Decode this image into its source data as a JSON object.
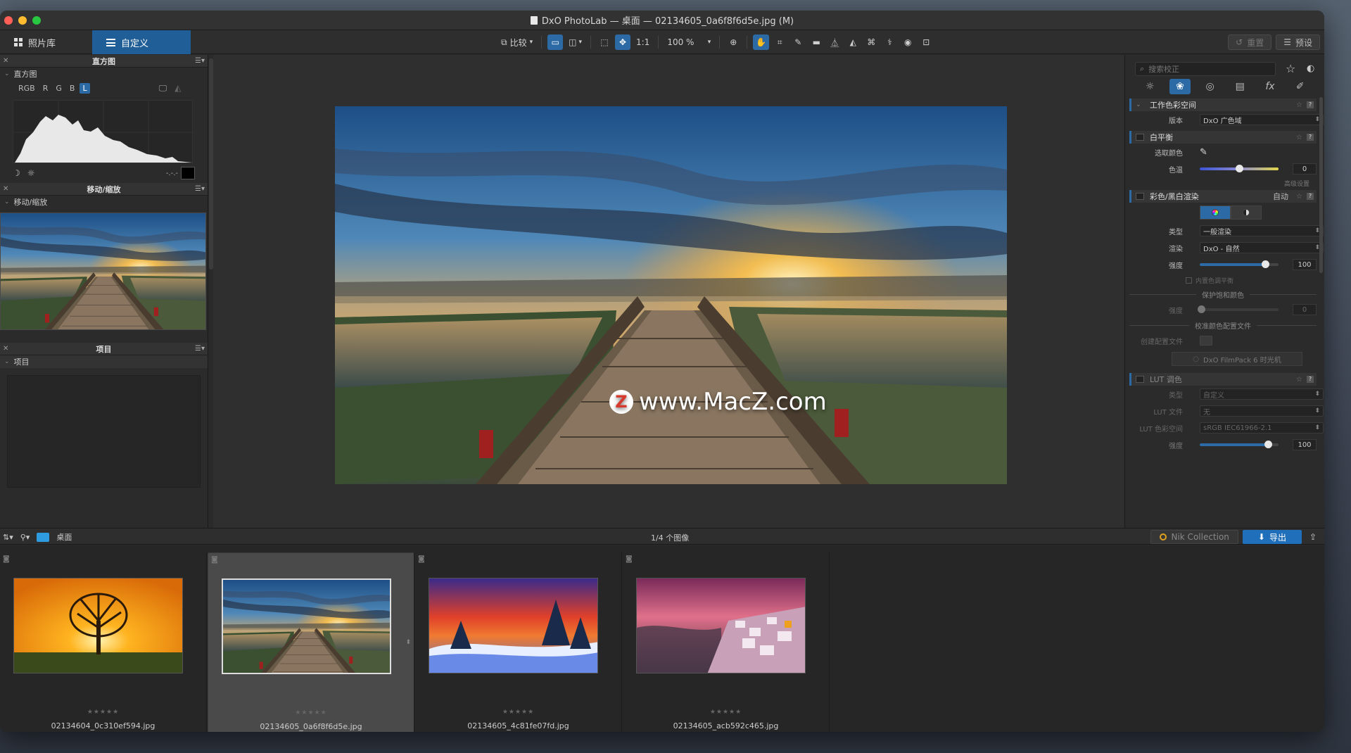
{
  "window": {
    "title": "DxO PhotoLab — 桌面 — 02134605_0a6f8f6d5e.jpg (M)"
  },
  "tabs": {
    "library": "照片库",
    "customize": "自定义"
  },
  "toolbar": {
    "compare": "比较",
    "one_to_one": "1:1",
    "zoom": "100 %",
    "reset": "重置",
    "presets": "预设"
  },
  "left": {
    "histogram": {
      "header": "直方图",
      "sub": "直方图",
      "channels": [
        "RGB",
        "R",
        "G",
        "B",
        "L"
      ],
      "active_channel": "L",
      "readout": "-.-.-"
    },
    "navigator": {
      "header": "移动/缩放",
      "sub": "移动/缩放"
    },
    "projects": {
      "header": "项目",
      "sub": "项目"
    }
  },
  "watermark": {
    "logo": "Z",
    "text": "www.MacZ.com"
  },
  "right": {
    "search_placeholder": "搜索校正",
    "sections": {
      "working_color_space": {
        "title": "工作色彩空间",
        "version_label": "版本",
        "version_value": "DxO 广色域"
      },
      "white_balance": {
        "title": "白平衡",
        "picker_label": "选取颜色",
        "temp_label": "色温",
        "temp_value": "0",
        "advanced": "高级设置"
      },
      "color_rendering": {
        "title": "彩色/黑白渲染",
        "mode": "自动",
        "type_label": "类型",
        "type_value": "一般渲染",
        "render_label": "渲染",
        "render_value": "DxO - 自然",
        "intensity_label": "强度",
        "intensity_value": "100",
        "intensity_fraction": 0.83,
        "tone_balance": "内置色调平衡",
        "protect_saturated": "保护饱和颜色",
        "protect_intensity_label": "强度",
        "protect_intensity_value": "0",
        "calibration_profile": "校准颜色配置文件",
        "create_profile": "创建配置文件",
        "filmpack_button": "DxO FilmPack 6 时光机"
      },
      "lut": {
        "title": "LUT 调色",
        "type_label": "类型",
        "type_value": "自定义",
        "file_label": "LUT 文件",
        "file_value": "无",
        "colorspace_label": "LUT 色彩空间",
        "colorspace_value": "sRGB IEC61966-2.1",
        "intensity_label": "强度",
        "intensity_value": "100",
        "intensity_fraction": 0.87
      }
    }
  },
  "filmbar": {
    "folder": "桌面",
    "count": "1/4 个图像",
    "nik": "Nik Collection",
    "export": "导出"
  },
  "filmstrip": [
    {
      "name": "02134604_0c310ef594.jpg",
      "stars": "★★★★★",
      "selected": false
    },
    {
      "name": "02134605_0a6f8f6d5e.jpg",
      "stars": "★★★★★",
      "selected": true
    },
    {
      "name": "02134605_4c81fe07fd.jpg",
      "stars": "★★★★★",
      "selected": false
    },
    {
      "name": "02134605_acb592c465.jpg",
      "stars": "★★★★★",
      "selected": false
    }
  ],
  "colors": {
    "accent": "#2c6aa6",
    "export": "#1f6fba"
  }
}
